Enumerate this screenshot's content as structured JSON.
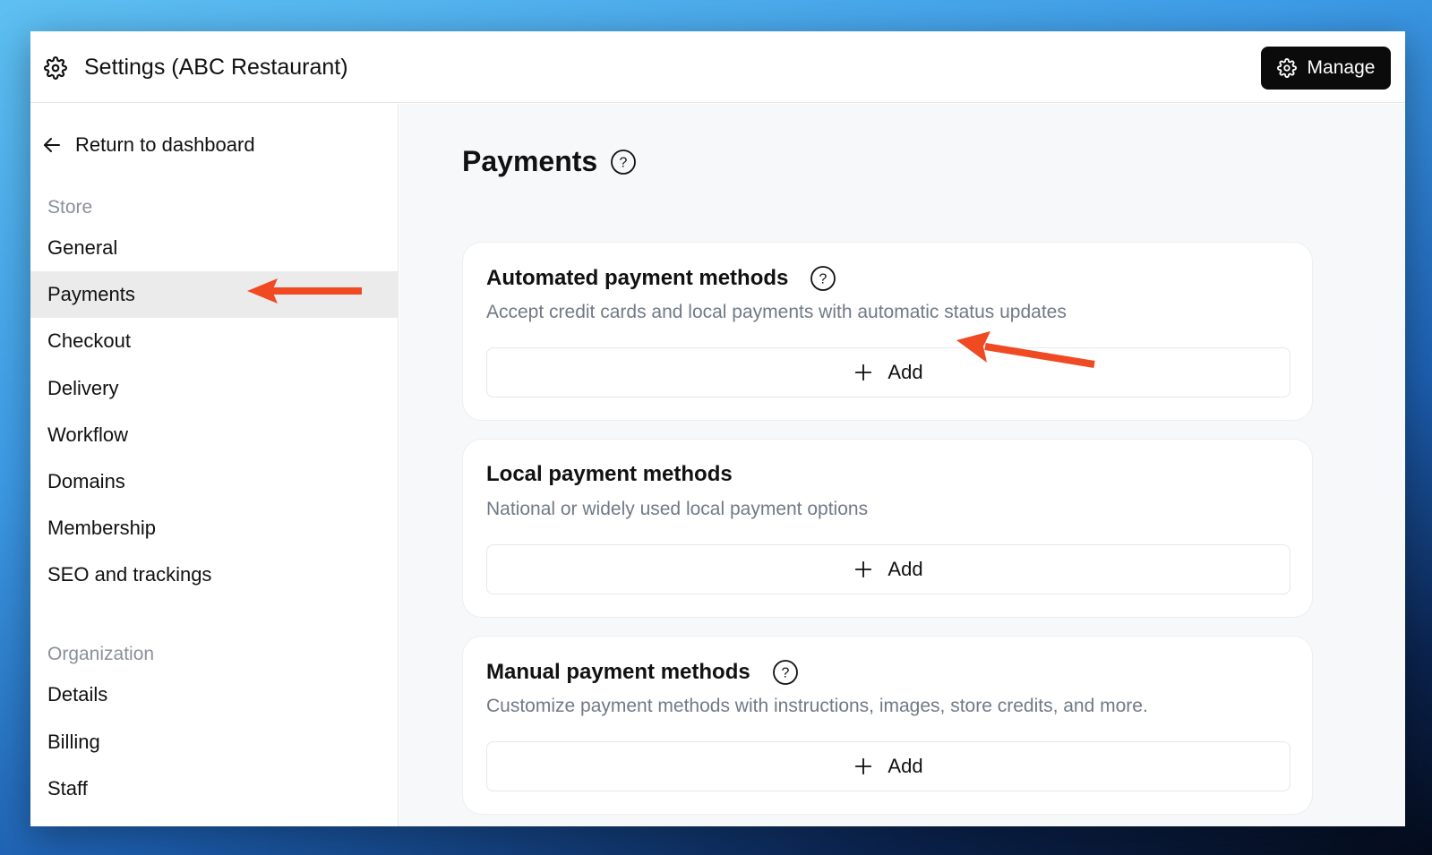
{
  "header": {
    "title": "Settings (ABC Restaurant)",
    "manage_label": "Manage"
  },
  "sidebar": {
    "back_label": "Return to dashboard",
    "sections": [
      {
        "label": "Store",
        "items": [
          {
            "label": "General"
          },
          {
            "label": "Payments",
            "active": true
          },
          {
            "label": "Checkout"
          },
          {
            "label": "Delivery"
          },
          {
            "label": "Workflow"
          },
          {
            "label": "Domains"
          },
          {
            "label": "Membership"
          },
          {
            "label": "SEO and trackings"
          }
        ]
      },
      {
        "label": "Organization",
        "items": [
          {
            "label": "Details"
          },
          {
            "label": "Billing"
          },
          {
            "label": "Staff"
          }
        ]
      }
    ]
  },
  "main": {
    "title": "Payments",
    "cards": [
      {
        "title": "Automated payment methods",
        "has_help": true,
        "description": "Accept credit cards and local payments with automatic status updates",
        "add_label": "Add"
      },
      {
        "title": "Local payment methods",
        "has_help": false,
        "description": "National or widely used local payment options",
        "add_label": "Add"
      },
      {
        "title": "Manual payment methods",
        "has_help": true,
        "description": "Customize payment methods with instructions, images, store credits, and more.",
        "add_label": "Add"
      }
    ]
  },
  "colors": {
    "annotation_arrow": "#f04a23",
    "active_nav_bg": "#ebebeb",
    "manage_bg": "#0b0b0b"
  },
  "icons": {
    "header": "gear-icon",
    "back": "arrow-left-icon",
    "help": "question-circle-icon",
    "add": "plus-icon"
  }
}
